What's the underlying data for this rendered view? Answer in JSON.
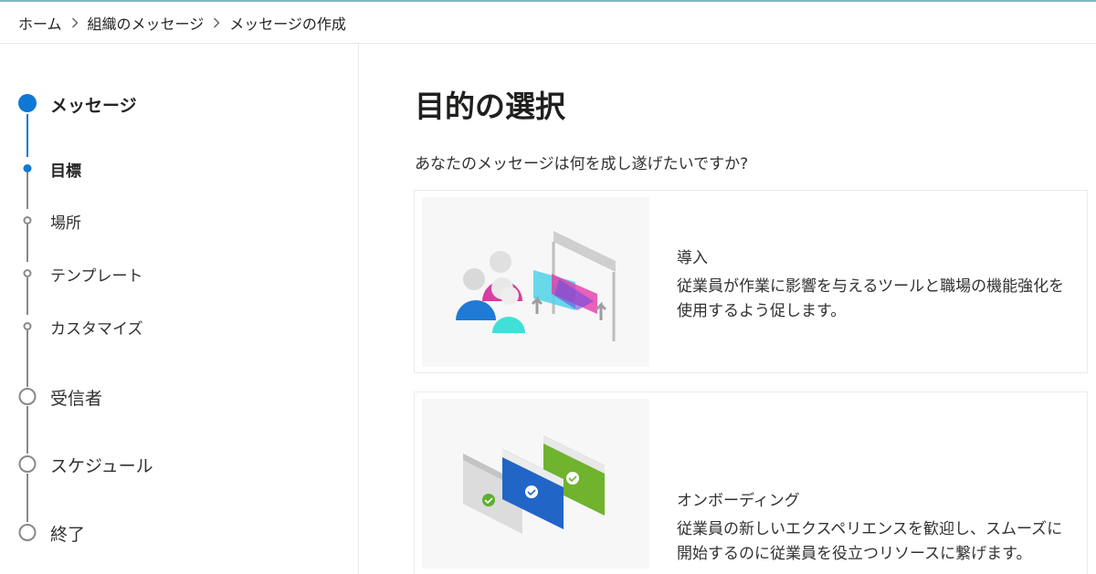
{
  "breadcrumb": {
    "items": [
      "ホーム",
      "組織のメッセージ",
      "メッセージの作成"
    ]
  },
  "steps": [
    {
      "label": "メッセージ",
      "kind": "main",
      "state": "active"
    },
    {
      "label": "目標",
      "kind": "sub",
      "state": "active"
    },
    {
      "label": "場所",
      "kind": "sub",
      "state": "pending"
    },
    {
      "label": "テンプレート",
      "kind": "sub",
      "state": "pending"
    },
    {
      "label": "カスタマイズ",
      "kind": "sub",
      "state": "pending"
    },
    {
      "label": "受信者",
      "kind": "main",
      "state": "pending"
    },
    {
      "label": "スケジュール",
      "kind": "main",
      "state": "pending"
    },
    {
      "label": "終了",
      "kind": "main",
      "state": "pending"
    }
  ],
  "main": {
    "title": "目的の選択",
    "subtitle": "あなたのメッセージは何を成し遂げたいですか?",
    "cards": [
      {
        "title": "導入",
        "description": "従業員が作業に影響を与えるツールと職場の機能強化を使用するよう促します。",
        "icon": "adoption-illustration"
      },
      {
        "title": "オンボーディング",
        "description": "従業員の新しいエクスペリエンスを歓迎し、スムーズに開始するのに従業員を役立つリソースに繋げます。",
        "icon": "onboarding-illustration"
      }
    ]
  },
  "colors": {
    "accent": "#0f78d4",
    "inactive": "#8a8886",
    "top_accent": "#7fb9c4"
  }
}
